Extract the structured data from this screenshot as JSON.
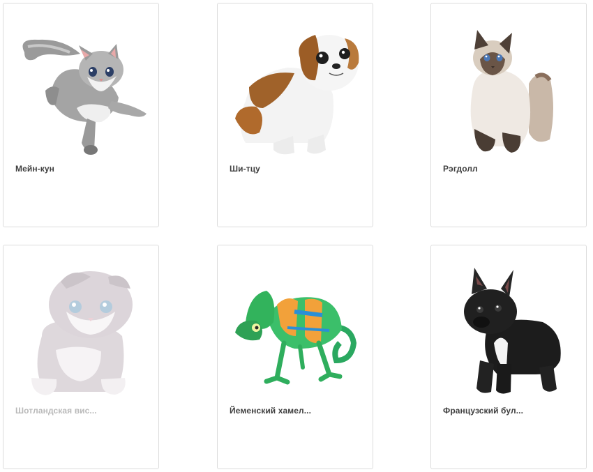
{
  "items": [
    {
      "title": "Мейн-кун",
      "icon": "maine-coon-kitten-image"
    },
    {
      "title": "Ши-тцу",
      "icon": "shih-tzu-puppy-image"
    },
    {
      "title": "Рэгдолл",
      "icon": "ragdoll-cat-image"
    },
    {
      "title": "Шотландская вис...",
      "icon": "scottish-fold-kitten-image",
      "state": "faded"
    },
    {
      "title": "Йеменский хамел...",
      "icon": "yemen-chameleon-image"
    },
    {
      "title": "Французский бул...",
      "icon": "french-bulldog-image"
    }
  ],
  "colors": {
    "card_border": "#dcdcdc",
    "title_text": "#3f3f3f",
    "title_text_faded": "#b9b9b9"
  }
}
